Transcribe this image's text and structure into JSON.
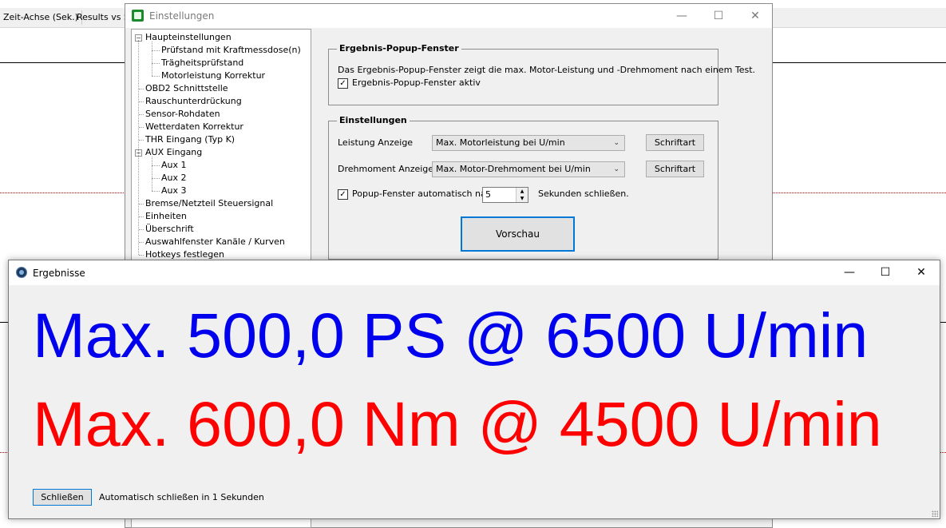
{
  "background": {
    "tabs": [
      "Zeit-Achse (Sek.)",
      "Results vs S"
    ]
  },
  "settings_window": {
    "title": "Einstellungen",
    "tree": [
      {
        "label": "Haupteinstellungen",
        "level": 0,
        "expander": "−"
      },
      {
        "label": "Prüfstand mit Kraftmessdose(n)",
        "level": 1
      },
      {
        "label": "Trägheitsprüfstand",
        "level": 1
      },
      {
        "label": "Motorleistung Korrektur",
        "level": 1
      },
      {
        "label": "OBD2 Schnittstelle",
        "level": 0
      },
      {
        "label": "Rauschunterdrückung",
        "level": 0
      },
      {
        "label": "Sensor-Rohdaten",
        "level": 0
      },
      {
        "label": "Wetterdaten Korrektur",
        "level": 0
      },
      {
        "label": "THR Eingang (Typ K)",
        "level": 0
      },
      {
        "label": "AUX Eingang",
        "level": 0,
        "expander": "−"
      },
      {
        "label": "Aux 1",
        "level": 1
      },
      {
        "label": "Aux 2",
        "level": 1
      },
      {
        "label": "Aux 3",
        "level": 1
      },
      {
        "label": "Bremse/Netzteil Steuersignal",
        "level": 0
      },
      {
        "label": "Einheiten",
        "level": 0
      },
      {
        "label": "Überschrift",
        "level": 0
      },
      {
        "label": "Auswahlfenster Kanäle / Kurven",
        "level": 0
      },
      {
        "label": "Hotkeys festlegen",
        "level": 0
      }
    ],
    "popup_group": {
      "title": "Ergebnis-Popup-Fenster",
      "description": "Das Ergebnis-Popup-Fenster zeigt die max. Motor-Leistung und -Drehmoment nach einem Test.",
      "checkbox_label": "Ergebnis-Popup-Fenster aktiv",
      "checked": true
    },
    "settings_group": {
      "title": "Einstellungen",
      "power_label": "Leistung Anzeige",
      "power_value": "Max. Motorleistung bei U/min",
      "torque_label": "Drehmoment Anzeige",
      "torque_value": "Max. Motor-Drehmoment bei U/min",
      "font_button": "Schriftart",
      "autoclose_label": "Popup-Fenster automatisch nach",
      "autoclose_checked": true,
      "autoclose_seconds": "5",
      "autoclose_suffix": "Sekunden schließen.",
      "preview_button": "Vorschau"
    }
  },
  "result_window": {
    "title": "Ergebnisse",
    "power_line": "Max. 500,0 PS @ 6500 U/min",
    "torque_line": "Max. 600,0 Nm @ 4500 U/min",
    "power_color": "#0000ee",
    "torque_color": "#ff0000",
    "close_button": "Schließen",
    "status": "Automatisch schließen in 1 Sekunden"
  }
}
